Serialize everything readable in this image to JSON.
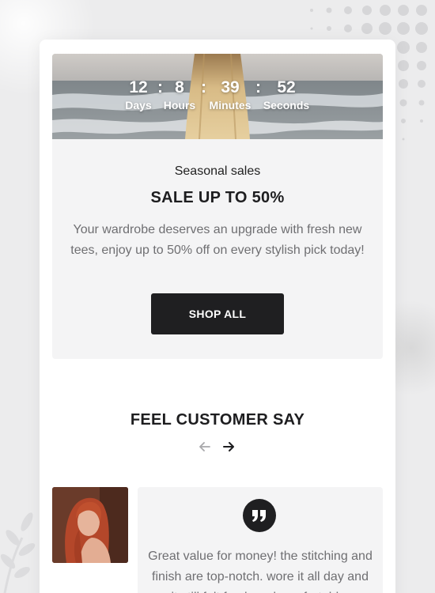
{
  "countdown": {
    "days": "12",
    "hours": "8",
    "minutes": "39",
    "seconds": "52",
    "days_label": "Days",
    "hours_label": "Hours",
    "minutes_label": "Minutes",
    "seconds_label": "Seconds",
    "separator": ":"
  },
  "sale": {
    "eyebrow": "Seasonal sales",
    "title": "SALE UP TO 50%",
    "description": "Your wardrobe deserves an upgrade with fresh new tees, enjoy up to 50% off on every stylish pick today!",
    "button_label": "SHOP ALL"
  },
  "testimonials": {
    "heading": "FEEL CUSTOMER SAY",
    "quote": "Great value for money! the stitching and finish are top-notch. wore it all day and it still felt fresh and comfortable."
  },
  "colors": {
    "background": "#ececed",
    "card": "#ffffff",
    "panel": "#f4f4f5",
    "button": "#1f1f21",
    "text_dark": "#1d1d1f",
    "text_muted": "#6f6f72",
    "arrow_inactive": "#a8a8ab"
  },
  "icons": {
    "prev": "arrow-left-icon",
    "next": "arrow-right-icon",
    "quote": "quote-icon"
  }
}
